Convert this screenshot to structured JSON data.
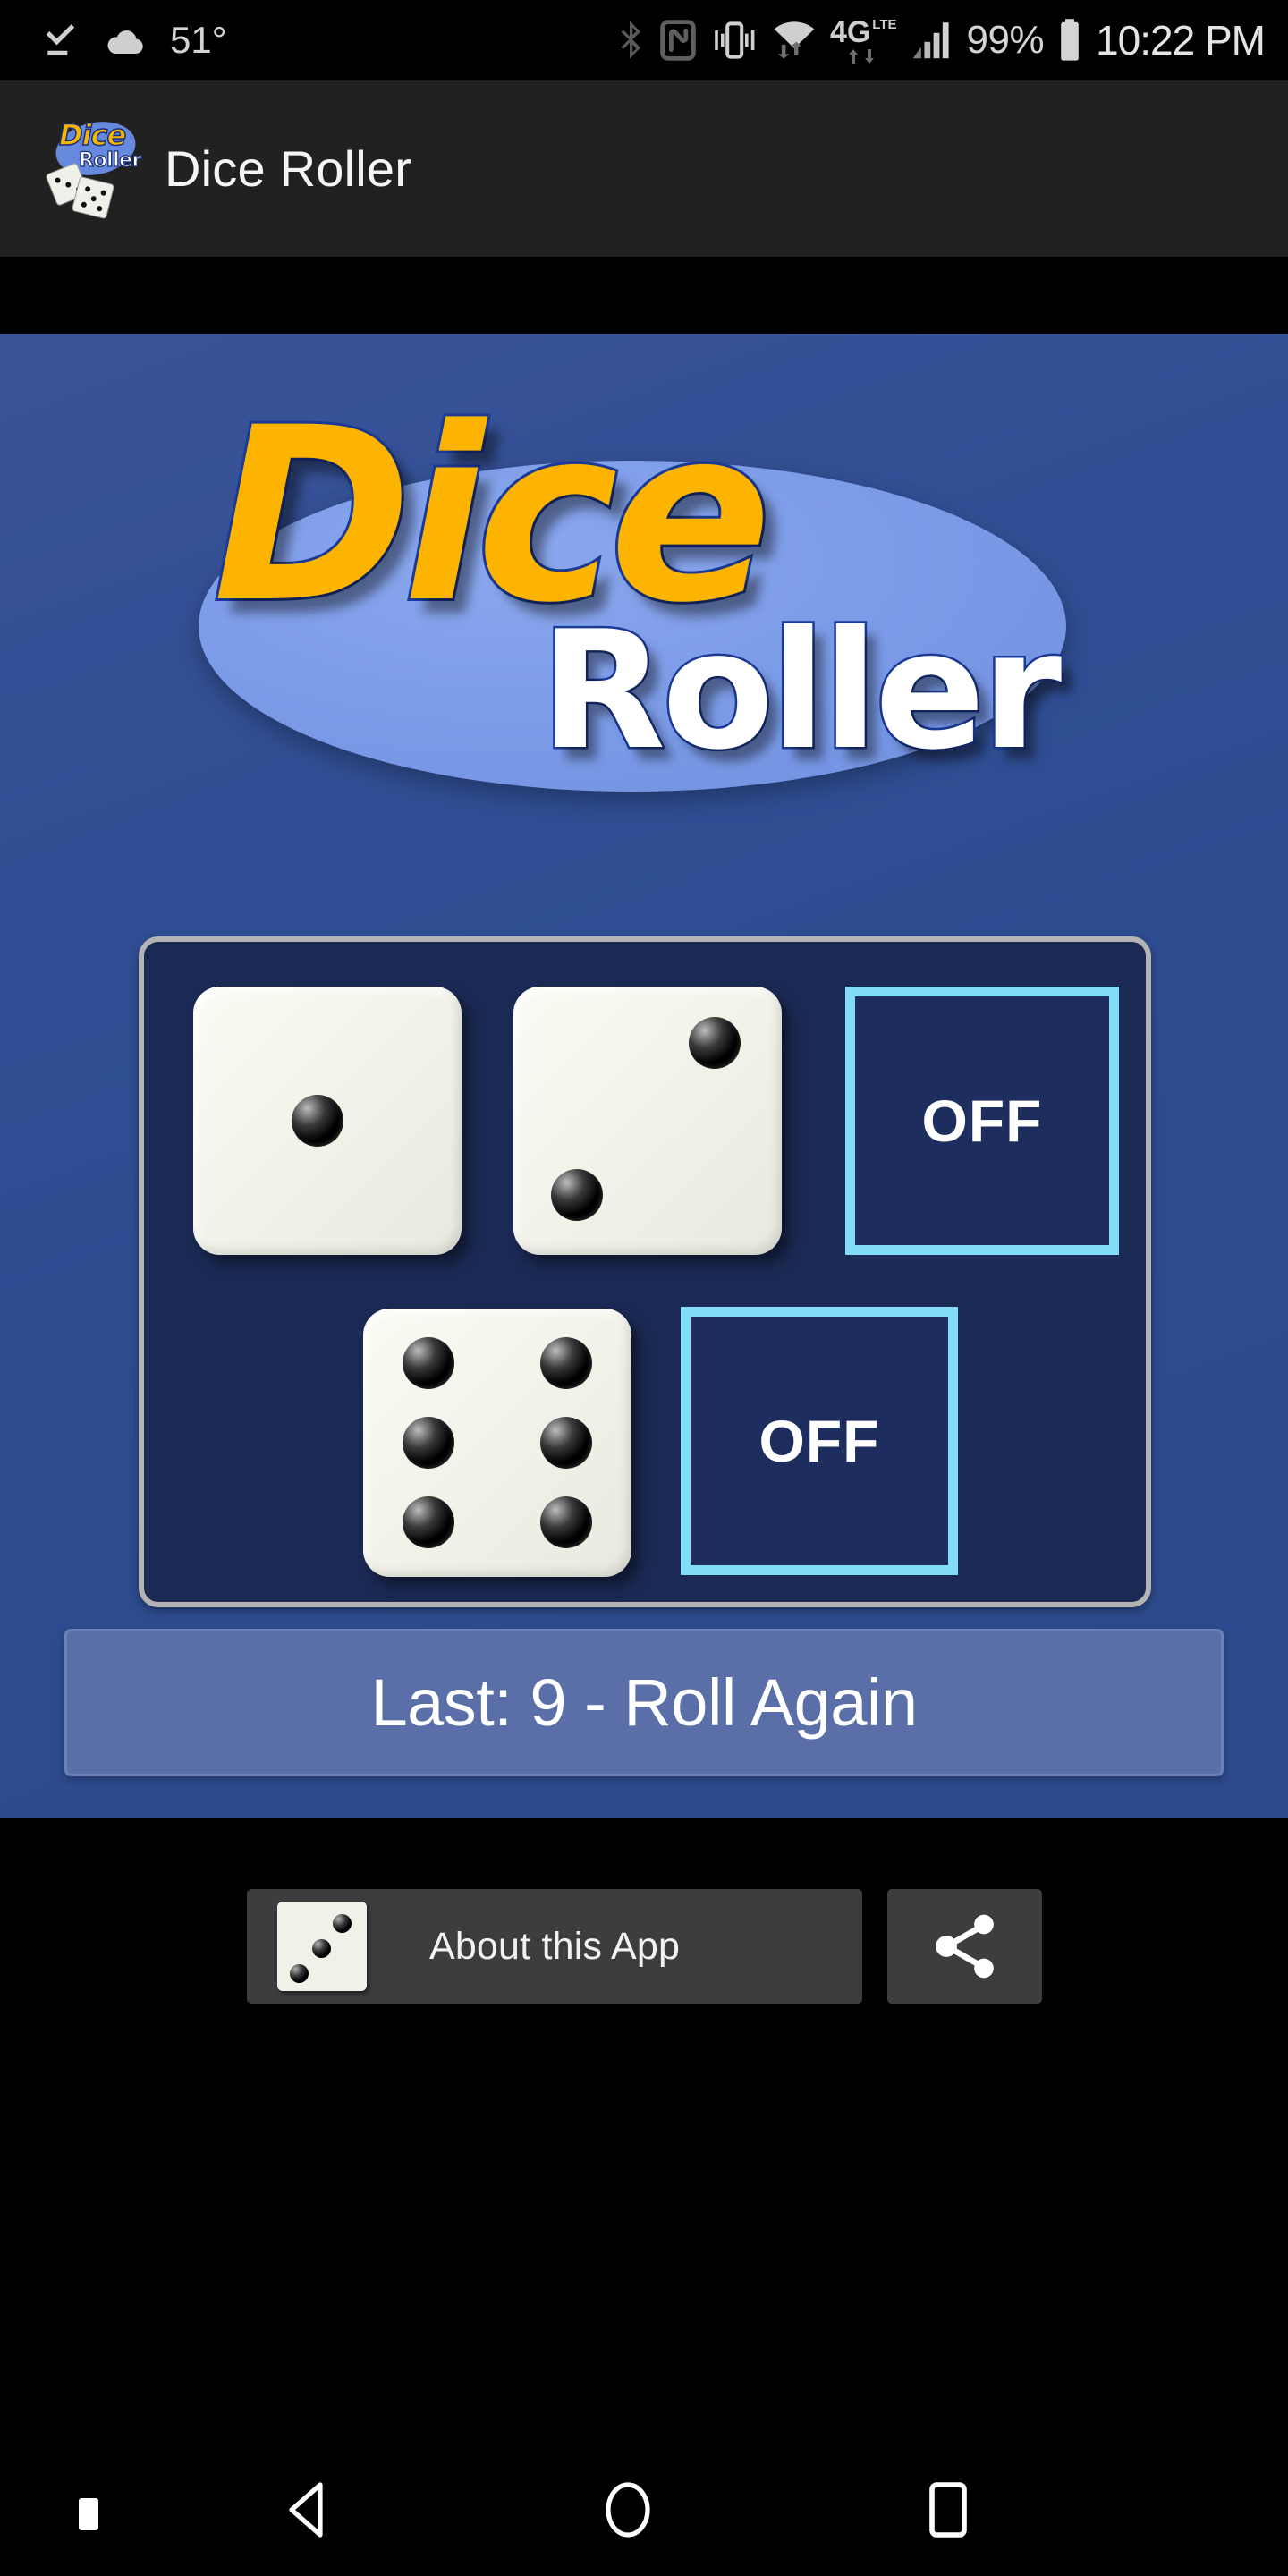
{
  "status_bar": {
    "temperature": "51°",
    "battery_percent": "99%",
    "time": "10:22 PM",
    "network_label": "4G",
    "network_sublabel": "LTE",
    "icons": [
      "download-complete-icon",
      "cloud-weather-icon",
      "bluetooth-icon",
      "nfc-icon",
      "vibrate-icon",
      "wifi-icon",
      "mobile-data-4glte-icon",
      "signal-bars-icon",
      "battery-icon"
    ]
  },
  "app_bar": {
    "title": "Dice Roller",
    "logo_dice_word": "Dice",
    "logo_roller_word": "Roller"
  },
  "main": {
    "logo": {
      "word_top": "Dice",
      "word_bottom": "Roller"
    },
    "dice_panel": {
      "dice": [
        {
          "name": "die-1",
          "value": 1
        },
        {
          "name": "die-2",
          "value": 2
        },
        {
          "name": "die-3",
          "value": 6
        }
      ],
      "toggles": [
        {
          "name": "die-4-toggle",
          "label": "OFF",
          "state": "off"
        },
        {
          "name": "die-5-toggle",
          "label": "OFF",
          "state": "off"
        }
      ]
    },
    "result_bar": {
      "text": "Last:  9 - Roll Again",
      "last_total": 9
    }
  },
  "bottom": {
    "about_button_label": "About this App",
    "about_die_value": 3,
    "share_button_label": "Share"
  },
  "nav_bar": {
    "items": [
      "menu-dot",
      "back-button",
      "home-button",
      "recents-button"
    ]
  },
  "colors": {
    "content_blue": "#2f4e93",
    "panel_navy": "#1b2a54",
    "toggle_border_cyan": "#81dcf8",
    "logo_gold": "#fcb400",
    "logo_outline_blue": "#1b3a96",
    "result_bar_blue": "#5a6ea8",
    "app_bar_dark": "#212121",
    "button_gray": "#3d3d3d"
  }
}
